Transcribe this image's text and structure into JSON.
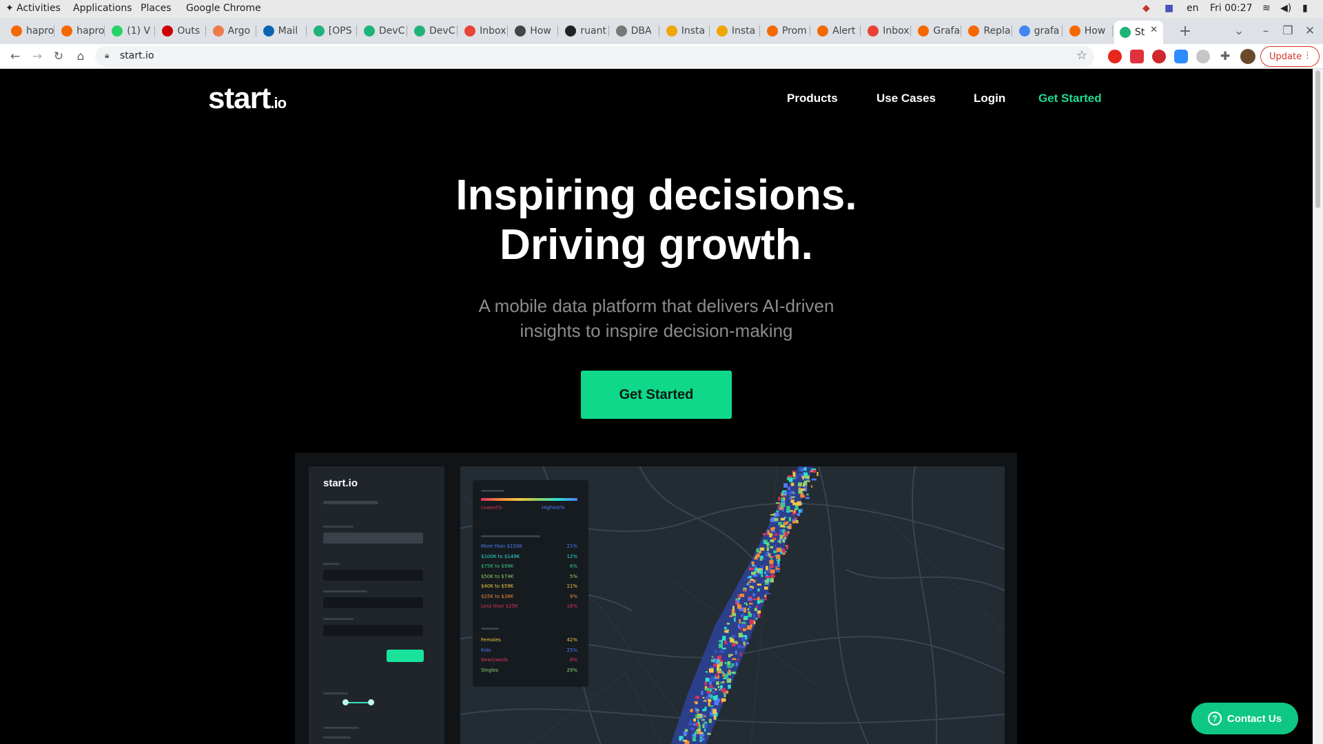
{
  "system_bar": {
    "activities": "Activities",
    "applications": "Applications",
    "places": "Places",
    "app_name": "Google Chrome",
    "keyboard_layout": "en",
    "clock": "Fri 00:27"
  },
  "tabs": [
    {
      "title": "hapro",
      "icon": "grafana-icon",
      "color": "#f46800"
    },
    {
      "title": "hapro",
      "icon": "grafana-icon",
      "color": "#f46800"
    },
    {
      "title": "(1) V",
      "icon": "whatsapp-icon",
      "color": "#25d366"
    },
    {
      "title": "Outs",
      "icon": "rsa-icon",
      "color": "#cc0000"
    },
    {
      "title": "Argo",
      "icon": "argo-icon",
      "color": "#ef7b4d"
    },
    {
      "title": "Mail",
      "icon": "outlook-icon",
      "color": "#0a64b4"
    },
    {
      "title": "[OPS",
      "icon": "atlassian-icon",
      "color": "#1fb37a"
    },
    {
      "title": "DevC",
      "icon": "atlassian-icon",
      "color": "#1fb37a"
    },
    {
      "title": "DevC",
      "icon": "atlassian-icon",
      "color": "#1fb37a"
    },
    {
      "title": "Inbox",
      "icon": "gmail-icon",
      "color": "#ea4335"
    },
    {
      "title": "How",
      "icon": "page-icon",
      "color": "#444444"
    },
    {
      "title": "ruant",
      "icon": "github-icon",
      "color": "#222222"
    },
    {
      "title": "DBA",
      "icon": "avatar-icon",
      "color": "#777777"
    },
    {
      "title": "Insta",
      "icon": "box-icon",
      "color": "#f0a500"
    },
    {
      "title": "Insta",
      "icon": "box-icon",
      "color": "#f0a500"
    },
    {
      "title": "Prom",
      "icon": "grafana-icon",
      "color": "#f46800"
    },
    {
      "title": "Alert",
      "icon": "grafana-icon",
      "color": "#f46800"
    },
    {
      "title": "Inbox",
      "icon": "gmail-icon",
      "color": "#ea4335"
    },
    {
      "title": "Grafa",
      "icon": "grafana-icon",
      "color": "#f46800"
    },
    {
      "title": "Repla",
      "icon": "grafana-icon",
      "color": "#f46800"
    },
    {
      "title": "grafa",
      "icon": "google-icon",
      "color": "#4285f4"
    },
    {
      "title": "How",
      "icon": "grafana-icon",
      "color": "#f46800"
    },
    {
      "title": "St",
      "icon": "startio-icon",
      "color": "#1fb37a",
      "active": true
    }
  ],
  "toolbar": {
    "url": "start.io",
    "update_label": "Update"
  },
  "site": {
    "logo_main": "start",
    "logo_suffix": ".io",
    "nav": {
      "products": "Products",
      "use_cases": "Use Cases",
      "login": "Login",
      "get_started": "Get Started"
    },
    "headline_line1": "Inspiring decisions.",
    "headline_line2": "Driving growth.",
    "subline_line1": "A mobile data platform that delivers AI-driven",
    "subline_line2": "insights to inspire decision-making",
    "cta_label": "Get Started",
    "contact_label": "Contact Us",
    "accent_color": "#1fdc8f"
  },
  "mockup": {
    "logo": "start.io",
    "legend": {
      "low": "Lowest%",
      "high": "Highest%",
      "income_rows": [
        {
          "label": "More than $150K",
          "pct": "21%",
          "color": "#4f7cff"
        },
        {
          "label": "$100K to $149K",
          "pct": "12%",
          "color": "#2be0d0"
        },
        {
          "label": "$75K to $99K",
          "pct": "6%",
          "color": "#37c98a"
        },
        {
          "label": "$50K to $74K",
          "pct": "5%",
          "color": "#8fd16a"
        },
        {
          "label": "$40K to $59K",
          "pct": "11%",
          "color": "#f3c641"
        },
        {
          "label": "$25K to $38K",
          "pct": "9%",
          "color": "#f08a3a"
        },
        {
          "label": "Less than $25K",
          "pct": "16%",
          "color": "#d9325b"
        }
      ],
      "segment_rows": [
        {
          "label": "Females",
          "pct": "42%",
          "color": "#f3c641"
        },
        {
          "label": "Kids",
          "pct": "25%",
          "color": "#4f7cff"
        },
        {
          "label": "Newlyweds",
          "pct": "8%",
          "color": "#d9325b"
        },
        {
          "label": "Singles",
          "pct": "29%",
          "color": "#8fd16a"
        }
      ]
    }
  }
}
